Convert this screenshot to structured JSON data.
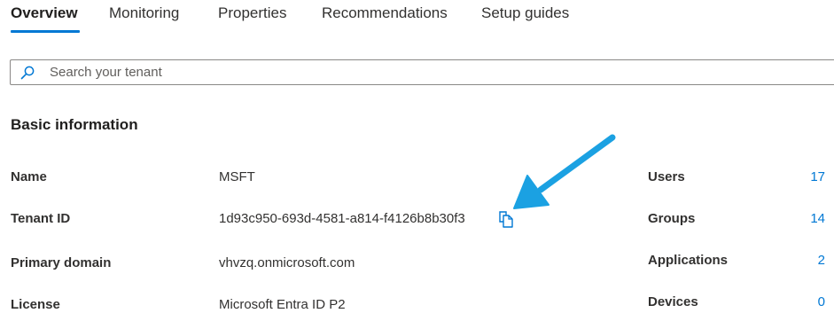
{
  "tabs": [
    {
      "label": "Overview",
      "active": true
    },
    {
      "label": "Monitoring",
      "active": false
    },
    {
      "label": "Properties",
      "active": false
    },
    {
      "label": "Recommendations",
      "active": false
    },
    {
      "label": "Setup guides",
      "active": false
    }
  ],
  "search": {
    "placeholder": "Search your tenant",
    "icon": "search-icon"
  },
  "basic_info": {
    "title": "Basic information",
    "rows": [
      {
        "label": "Name",
        "value": "MSFT"
      },
      {
        "label": "Tenant ID",
        "value": "1d93c950-693d-4581-a814-f4126b8b30f3",
        "copy_icon": "copy-icon"
      },
      {
        "label": "Primary domain",
        "value": "vhvzq.onmicrosoft.com"
      },
      {
        "label": "License",
        "value": "Microsoft Entra ID P2"
      }
    ]
  },
  "stats": [
    {
      "label": "Users",
      "count": "17"
    },
    {
      "label": "Groups",
      "count": "14"
    },
    {
      "label": "Applications",
      "count": "2"
    },
    {
      "label": "Devices",
      "count": "0"
    }
  ],
  "colors": {
    "accent": "#0078d4",
    "annotation_arrow": "#1ba1e2",
    "text": "#323130",
    "border": "#8a8886"
  }
}
